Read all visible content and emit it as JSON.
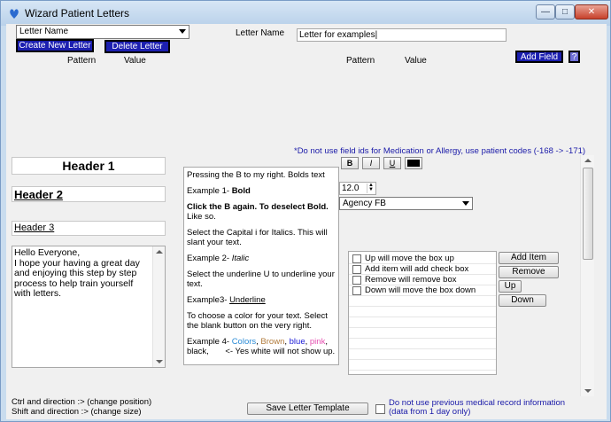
{
  "window": {
    "title": "Wizard Patient Letters"
  },
  "top": {
    "letter_combo": "Letter Name",
    "create_btn": "Create New Letter",
    "delete_btn": "Delete Letter",
    "pattern_lbl": "Pattern",
    "value_lbl": "Value",
    "letter_name_lbl": "Letter Name",
    "letter_name_value": "Letter for examples",
    "pattern_lbl2": "Pattern",
    "value_lbl2": "Value",
    "add_field_btn": "Add Field",
    "help_btn": "?"
  },
  "note": "*Do not use field ids for Medication or Allergy, use patient codes (-168 -> -171)",
  "headers": {
    "h1": "Header 1",
    "h2": "Header 2",
    "h3": "Header 3"
  },
  "body_text": "Hello Everyone,\nI hope your having a great day and enjoying this step by step process to help train yourself with letters.",
  "instructions": {
    "p1": "Pressing the B to my right. Bolds text",
    "p2_prefix": "Example 1- ",
    "p2_bold": "Bold",
    "p3_bold": "Click the B again. To deselect Bold.",
    "p3_rest": " Like so.",
    "p4": "Select the Capital i for Italics. This will slant your text.",
    "p5_prefix": "Example 2- ",
    "p5_italic": "Italic",
    "p6": "Select the underline U to underline your text.",
    "p7_prefix": "Example3- ",
    "p7_underline": "Underline",
    "p8": "To choose a color for your text. Select the blank button on the very right.",
    "p9_prefix": "Example 4- ",
    "p9_colors": "Colors",
    "p9_brown": "Brown",
    "p9_blue": "blue",
    "p9_pink": "pink",
    "p9_black": "black,",
    "p9_rest": "<- Yes white will not show up."
  },
  "format": {
    "bold": "B",
    "italic": "I",
    "underline": "U",
    "font_size": "12.0",
    "font_name": "Agency FB"
  },
  "checklist": {
    "items": [
      "Up will move the box up",
      "Add item will add check box",
      "Remove will remove box",
      "Down will move the box down"
    ],
    "add_btn": "Add Item",
    "remove_btn": "Remove",
    "up_btn": "Up",
    "down_btn": "Down"
  },
  "footer": {
    "hint1": "Ctrl and direction :> (change position)",
    "hint2": "Shift and direction :> (change size)",
    "save_btn": "Save Letter Template",
    "no_prev": "Do not use previous medical record information (data from 1 day only)"
  },
  "colors": {
    "accent_blue": "#1c1fb0",
    "note_blue": "#1a1aa8",
    "color_swatch": "#000000"
  }
}
